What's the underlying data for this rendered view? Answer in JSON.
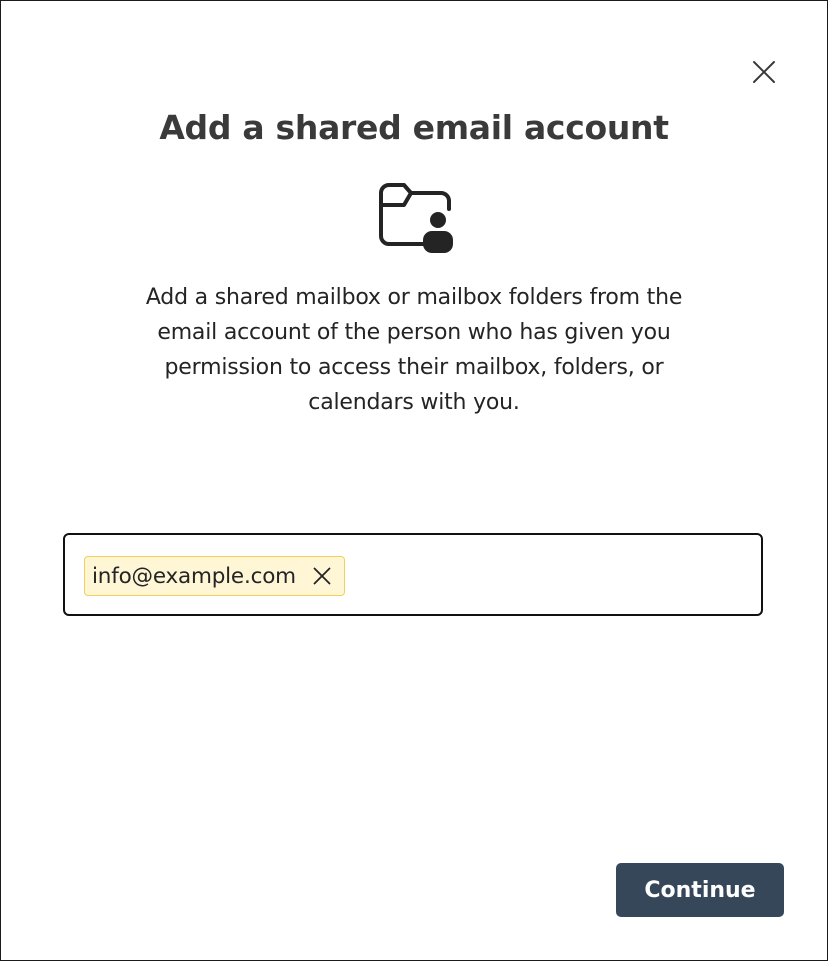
{
  "dialog": {
    "title": "Add a shared email account",
    "hero_icon": "folder-person-icon",
    "description": "Add a shared mailbox or mailbox folders from the email account of the person who has given you permission to access their mailbox, folders, or calendars with you.",
    "close_icon": "close-icon"
  },
  "recipient_field": {
    "value": "",
    "chips": [
      {
        "label": "info@example.com",
        "remove_icon": "dismiss-icon"
      }
    ]
  },
  "footer": {
    "continue_label": "Continue"
  },
  "colors": {
    "primary_button": "#36475a",
    "chip_background": "#fff6d6",
    "chip_border": "#f1d159",
    "field_border": "#111111",
    "title_text": "#3a3a3a"
  }
}
